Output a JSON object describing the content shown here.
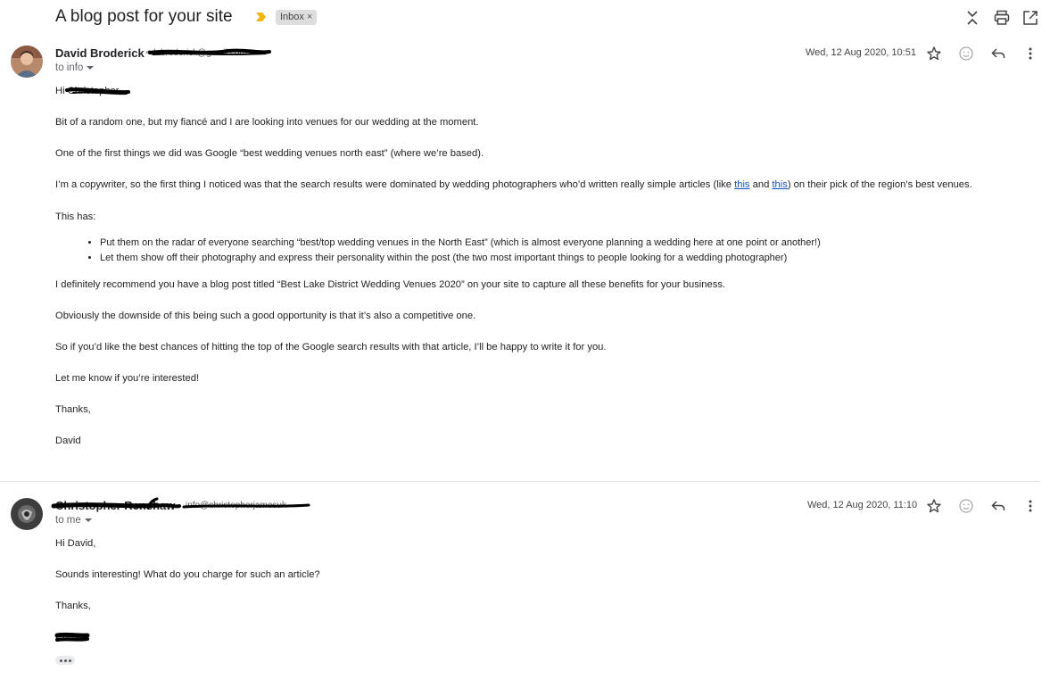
{
  "subject": "A blog post for your site",
  "label": "Inbox",
  "colors": {
    "importance": "#f4b400",
    "link": "#1155cc",
    "text": "#222222"
  },
  "top_actions": [
    "collapse-all-icon",
    "print-icon",
    "open-in-new-window-icon"
  ],
  "messages": [
    {
      "sender_name": "David Broderick",
      "sender_email": "<dabroderick@gmail.com>",
      "to": "to info",
      "date": "Wed, 12 Aug 2020, 10:51",
      "greeting": "Hi Christopher,",
      "p1": "Bit of a random one, but my fiancé and I are looking into venues for our wedding at the moment.",
      "p2": "One of the first things we did was Google “best wedding venues north east” (where we’re based).",
      "p3_before": "I’m a copywriter, so the first thing I noticed was that the search results were dominated by wedding photographers who’d written really simple articles (like ",
      "link1": "this",
      "p3_middle": " and ",
      "link2": "this",
      "p3_after": ") on their pick of the region’s best venues.",
      "p4": "This has:",
      "bullets": [
        "Put them on the radar of everyone searching “best/top wedding venues in the North East” (which is almost everyone planning a wedding here at one point or another!)",
        "Let them show off their photography and express their personality within the post (the two most important things to people looking for a wedding photographer)"
      ],
      "p5": "I definitely recommend you have a blog post titled “Best Lake District Wedding Venues 2020” on your site to capture all these benefits for your business.",
      "p6": "Obviously the downside of this being such a good opportunity is that it’s also a competitive one.",
      "p7": "So if you’d like the best chances of hitting the top of the Google search results with that article, I’ll be happy to write it for you.",
      "p8": "Let me know if you’re interested!",
      "p9": "Thanks,",
      "p10": "David"
    },
    {
      "sender_name": "Christopher Renshaw",
      "sender_email": "info@christopherjamesuk",
      "to": "to me",
      "date": "Wed, 12 Aug 2020, 11:10",
      "greeting": "Hi David,",
      "p1": "Sounds interesting! What do you charge for such an article?",
      "p2": "Thanks,",
      "signature": "Chris"
    }
  ]
}
